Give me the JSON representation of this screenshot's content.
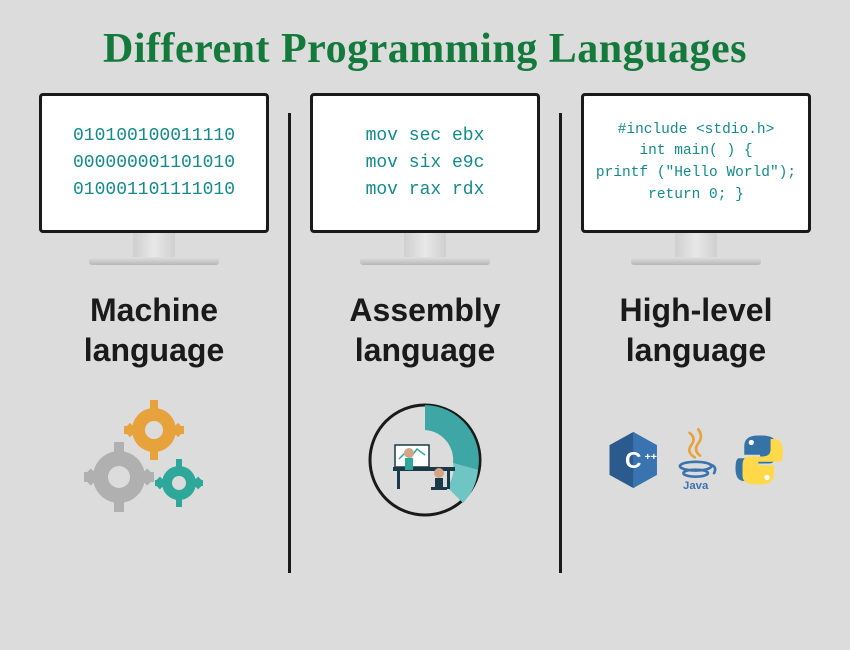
{
  "title": "Different Programming Languages",
  "columns": [
    {
      "label_line1": "Machine",
      "label_line2": "language",
      "code": [
        "010100100011110",
        "000000001101010",
        "010001101111010"
      ],
      "icon": "gears"
    },
    {
      "label_line1": "Assembly",
      "label_line2": "language",
      "code": [
        "mov sec ebx",
        "mov six e9c",
        "mov rax rdx"
      ],
      "icon": "chart-desk"
    },
    {
      "label_line1": "High-level",
      "label_line2": "language",
      "code": [
        "#include <stdio.h>",
        "int main( ) {",
        "printf (\"Hello World\");",
        "return 0; }"
      ],
      "icon": "lang-logos",
      "logos": [
        "C++",
        "Java",
        "Python"
      ]
    }
  ],
  "colors": {
    "title": "#147a3b",
    "code": "#158a8a",
    "text": "#1a1a1a"
  }
}
